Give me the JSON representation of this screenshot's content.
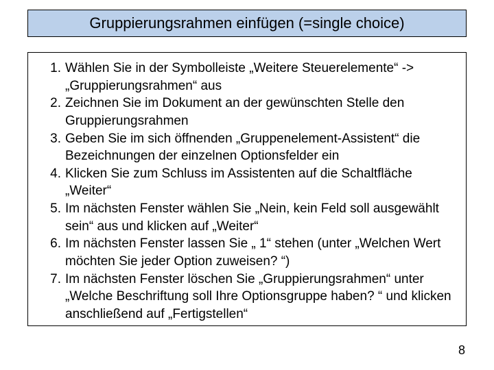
{
  "title": "Gruppierungsrahmen einfügen (=single choice)",
  "steps": [
    "Wählen Sie in der Symbolleiste „Weitere Steuerelemente“ -> „Gruppierungsrahmen“ aus",
    "Zeichnen Sie im Dokument an der gewünschten Stelle den Gruppierungsrahmen",
    "Geben Sie im sich öffnenden „Gruppenelement-Assistent“ die Bezeichnungen der einzelnen Optionsfelder ein",
    "Klicken Sie zum Schluss im Assistenten auf die Schaltfläche „Weiter“",
    "Im nächsten Fenster wählen Sie „Nein, kein Feld soll ausgewählt sein“ aus und klicken auf „Weiter“",
    "Im nächsten Fenster lassen Sie „ 1“ stehen (unter „Welchen Wert möchten Sie jeder Option zuweisen? “)",
    "Im nächsten Fenster löschen Sie „Gruppierungsrahmen“ unter „Welche Beschriftung soll Ihre Optionsgruppe haben? “ und klicken anschließend auf „Fertigstellen“"
  ],
  "page_number": "8"
}
